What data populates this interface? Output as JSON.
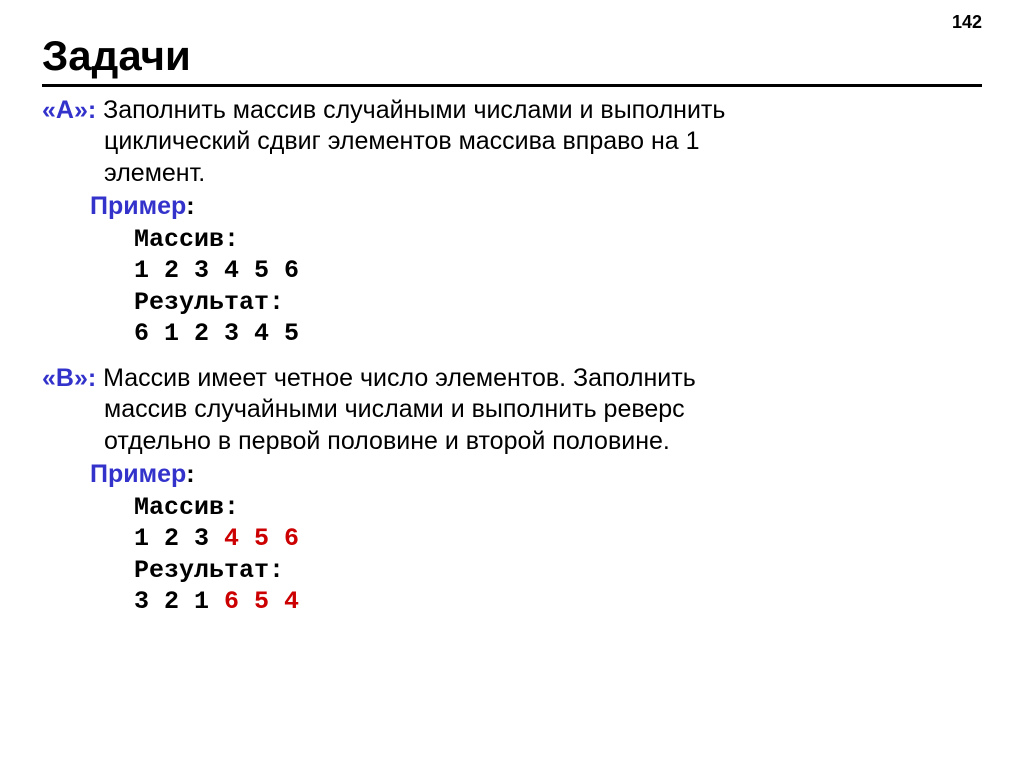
{
  "page_number": "142",
  "title": "Задачи",
  "task_a": {
    "label": "«A»:",
    "text_line1": " Заполнить массив случайными числами и выполнить",
    "text_line2": "циклический сдвиг элементов массива вправо на 1",
    "text_line3": "элемент.",
    "example_label": "Пример:",
    "code": {
      "line1": "Массив:",
      "line2": "1 2 3 4 5 6",
      "line3": "Результат:",
      "line4": "6 1 2 3 4 5"
    }
  },
  "task_b": {
    "label": "«B»:",
    "text_line1": " Массив имеет четное число элементов. Заполнить",
    "text_line2": "массив случайными числами и выполнить реверс",
    "text_line3": "отдельно в первой половине и второй половине.",
    "example_label": "Пример:",
    "code": {
      "line1": "Массив:",
      "line2_part1": "1 2 3 ",
      "line2_part2": "4 5 6",
      "line3": "Результат:",
      "line4_part1": "3 2 1 ",
      "line4_part2": "6 5 4"
    }
  }
}
